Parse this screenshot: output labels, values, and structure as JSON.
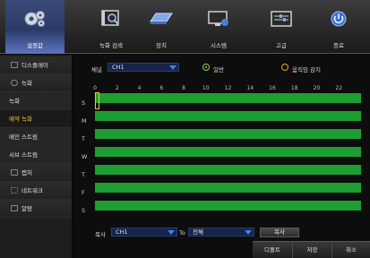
{
  "top_menu": [
    {
      "label": "설정값",
      "icon": "gear-icon"
    },
    {
      "label": "녹화 검색",
      "icon": "search-video-icon"
    },
    {
      "label": "장치",
      "icon": "hard-drive-icon"
    },
    {
      "label": "시스템",
      "icon": "monitor-icon"
    },
    {
      "label": "고급",
      "icon": "advanced-icon"
    },
    {
      "label": "종료",
      "icon": "power-icon"
    }
  ],
  "sidebar": [
    "디스플레이",
    "녹화",
    "녹화",
    "예약 녹화",
    "메인 스트림",
    "서브 스트림",
    "캡처",
    "네트워크",
    "알람"
  ],
  "schedule": {
    "channel_label": "채널",
    "channel_value": "CH1",
    "mode_normal": "일반",
    "mode_motion": "움직임 감지",
    "hours": [
      "0",
      "2",
      "4",
      "6",
      "8",
      "10",
      "12",
      "14",
      "16",
      "18",
      "20",
      "22"
    ],
    "days": [
      "S",
      "M",
      "T",
      "W",
      "T",
      "F",
      "S"
    ],
    "normal_color": "#1e9e32",
    "motion_color": "#e8a81c"
  },
  "copy": {
    "label": "복사",
    "from_value": "CH1",
    "to_label": "To",
    "to_value": "전체",
    "button": "복사"
  },
  "footer": {
    "default": "디폴트",
    "save": "저장",
    "cancel": "취소"
  }
}
